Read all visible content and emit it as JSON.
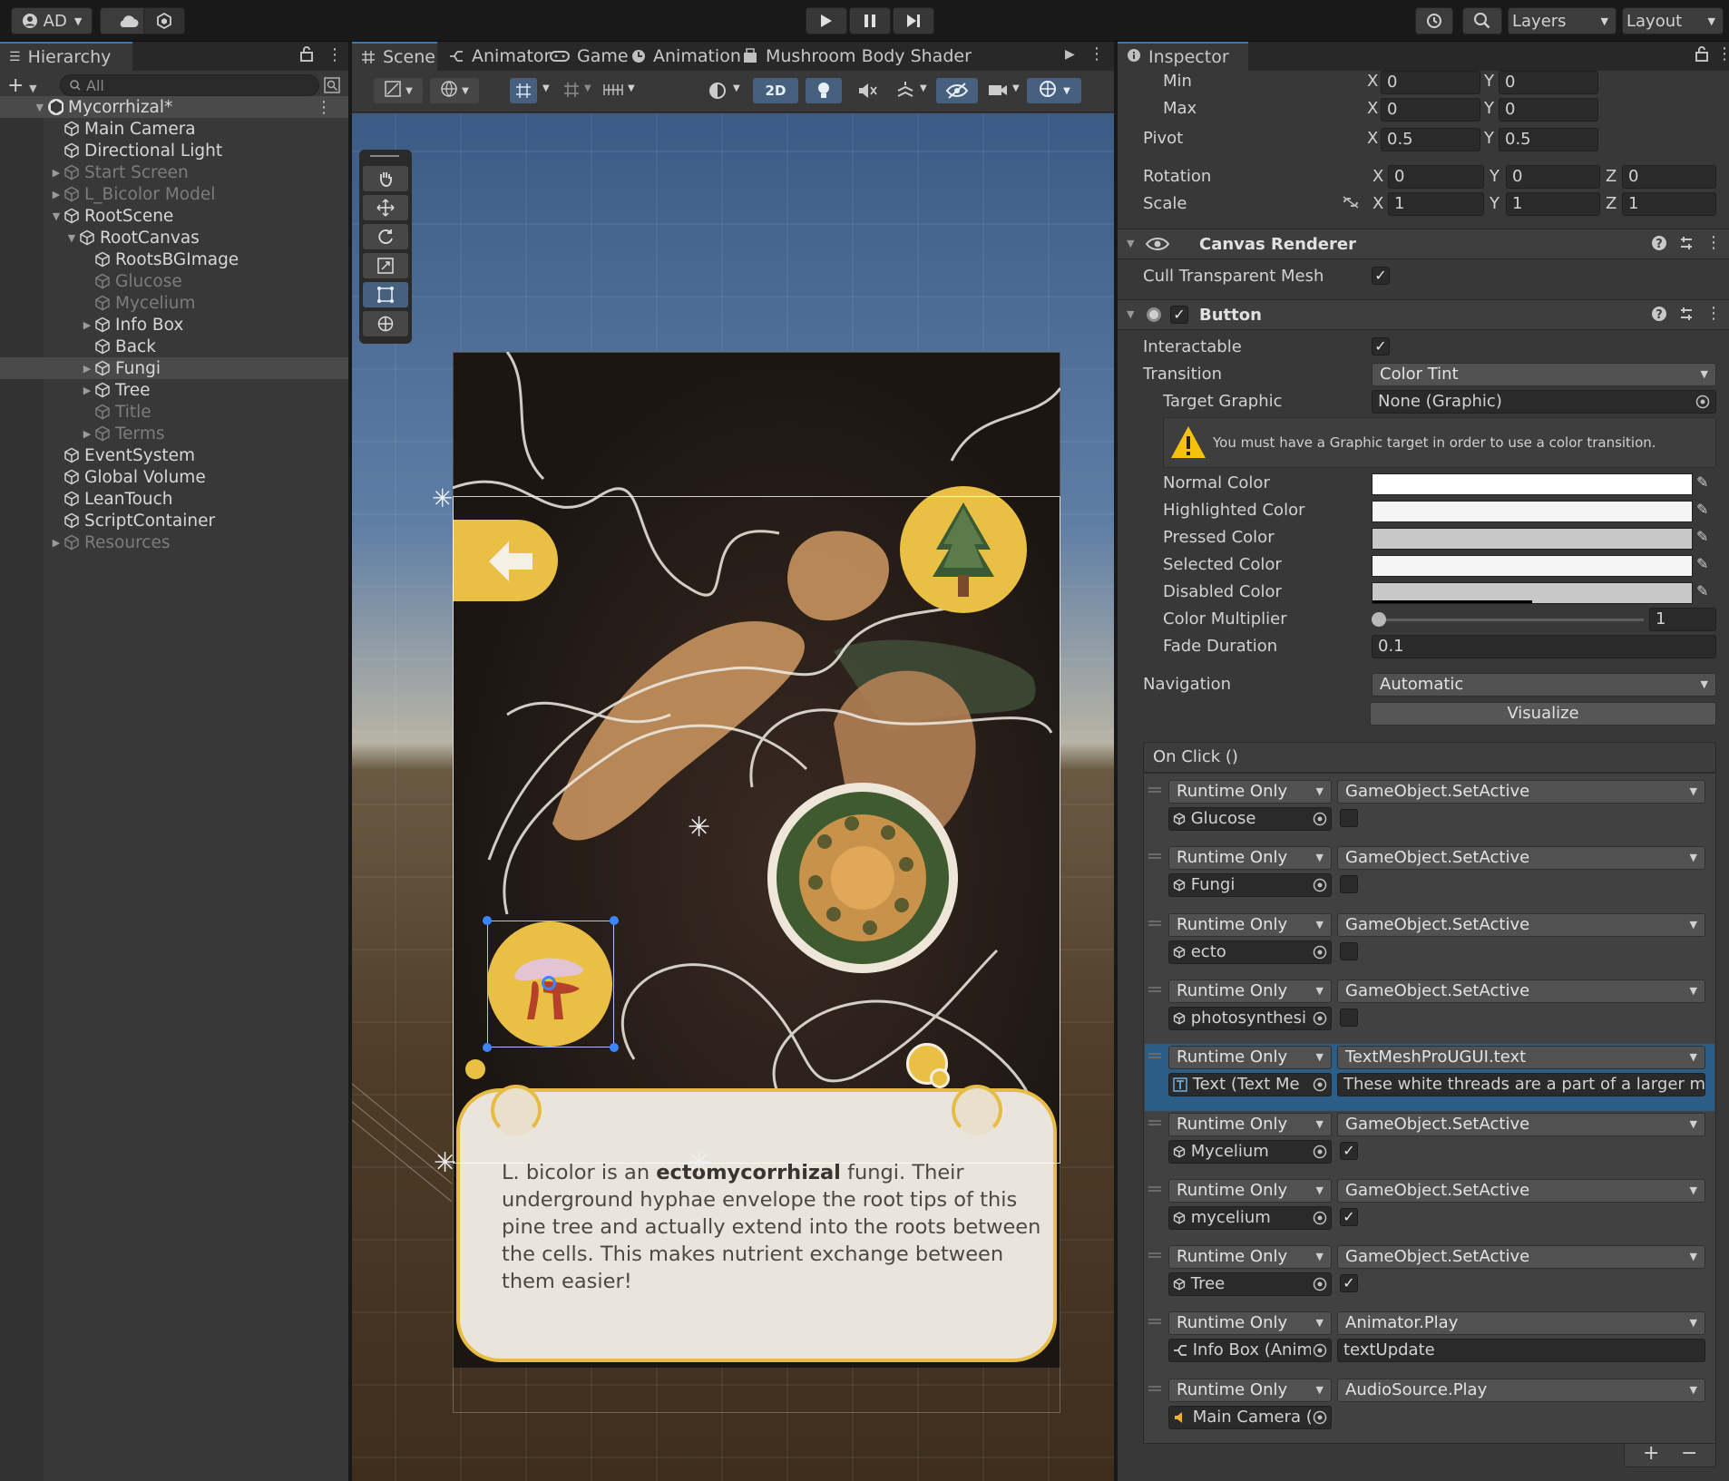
{
  "toolbar": {
    "account": "AD",
    "layers_label": "Layers",
    "layout_label": "Layout"
  },
  "hierarchy": {
    "tab_label": "Hierarchy",
    "search_placeholder": "All",
    "root": "Mycorrhizal*",
    "items": [
      {
        "label": "Main Camera",
        "dim": false
      },
      {
        "label": "Directional Light",
        "dim": false
      },
      {
        "label": "Start Screen",
        "dim": true
      },
      {
        "label": "L_Bicolor Model",
        "dim": true
      },
      {
        "label": "RootScene",
        "dim": false
      },
      {
        "label": "RootCanvas",
        "dim": false
      },
      {
        "label": "RootsBGImage",
        "dim": false
      },
      {
        "label": "Glucose",
        "dim": true
      },
      {
        "label": "Mycelium",
        "dim": true
      },
      {
        "label": "Info Box",
        "dim": false
      },
      {
        "label": "Back",
        "dim": false
      },
      {
        "label": "Fungi",
        "dim": false
      },
      {
        "label": "Tree",
        "dim": false
      },
      {
        "label": "Title",
        "dim": true
      },
      {
        "label": "Terms",
        "dim": true
      },
      {
        "label": "EventSystem",
        "dim": false
      },
      {
        "label": "Global Volume",
        "dim": false
      },
      {
        "label": "LeanTouch",
        "dim": false
      },
      {
        "label": "ScriptContainer",
        "dim": false
      },
      {
        "label": "Resources",
        "dim": true
      }
    ]
  },
  "scene_tabs": [
    "Scene",
    "Animator",
    "Game",
    "Animation",
    "Mushroom Body Shader"
  ],
  "scene_toolbar": {
    "mode_2d": "2D"
  },
  "scene_card": {
    "text_before": "L. bicolor is an ",
    "text_bold": "ectomycorrhizal",
    "text_after": " fungi. Their underground hyphae envelope the root tips of this pine tree and actually extend into the roots between the cells. This makes nutrient exchange between them easier!"
  },
  "inspector": {
    "tab_label": "Inspector",
    "rect": {
      "min_label": "Min",
      "max_label": "Max",
      "pivot_label": "Pivot",
      "min_x": "0",
      "min_y": "0",
      "max_x": "0",
      "max_y": "0",
      "pivot_x": "0.5",
      "pivot_y": "0.5",
      "rotation_label": "Rotation",
      "scale_label": "Scale",
      "rot": [
        "0",
        "0",
        "0"
      ],
      "scale": [
        "1",
        "1",
        "1"
      ],
      "x": "X",
      "y": "Y",
      "z": "Z"
    },
    "canvas_renderer": {
      "title": "Canvas Renderer",
      "cull_label": "Cull Transparent Mesh",
      "cull": true
    },
    "button": {
      "title": "Button",
      "interactable_label": "Interactable",
      "transition_label": "Transition",
      "transition": "Color Tint",
      "target_label": "Target Graphic",
      "target": "None (Graphic)",
      "warning": "You must have a Graphic target in order to use a color transition.",
      "normal_label": "Normal Color",
      "highlighted_label": "Highlighted Color",
      "pressed_label": "Pressed Color",
      "selected_label": "Selected Color",
      "disabled_label": "Disabled Color",
      "multiplier_label": "Color Multiplier",
      "multiplier": "1",
      "fade_label": "Fade Duration",
      "fade": "0.1",
      "navigation_label": "Navigation",
      "navigation": "Automatic",
      "visualize": "Visualize",
      "onclick_label": "On Click ()",
      "colors": {
        "normal": "#ffffff",
        "highlighted": "#f5f5f5",
        "pressed": "#c8c8c8",
        "selected": "#f5f5f5",
        "disabled": "#c8c8c8"
      }
    },
    "events": [
      {
        "runtime": "Runtime Only",
        "func": "GameObject.SetActive",
        "object": "Glucose",
        "arg_type": "check",
        "arg": false,
        "obj_icon": "cube"
      },
      {
        "runtime": "Runtime Only",
        "func": "GameObject.SetActive",
        "object": "Fungi",
        "arg_type": "check",
        "arg": false,
        "obj_icon": "cube"
      },
      {
        "runtime": "Runtime Only",
        "func": "GameObject.SetActive",
        "object": "ecto",
        "arg_type": "check",
        "arg": false,
        "obj_icon": "cube"
      },
      {
        "runtime": "Runtime Only",
        "func": "GameObject.SetActive",
        "object": "photosynthesi",
        "arg_type": "check",
        "arg": false,
        "obj_icon": "cube"
      },
      {
        "runtime": "Runtime Only",
        "func": "TextMeshProUGUI.text",
        "object": "Text (Text Me",
        "arg_type": "text",
        "arg": "These white threads are a part of a larger myc",
        "obj_icon": "text",
        "selected": true
      },
      {
        "runtime": "Runtime Only",
        "func": "GameObject.SetActive",
        "object": "Mycelium",
        "arg_type": "check",
        "arg": true,
        "obj_icon": "cube"
      },
      {
        "runtime": "Runtime Only",
        "func": "GameObject.SetActive",
        "object": "mycelium",
        "arg_type": "check",
        "arg": true,
        "obj_icon": "cube"
      },
      {
        "runtime": "Runtime Only",
        "func": "GameObject.SetActive",
        "object": "Tree",
        "arg_type": "check",
        "arg": true,
        "obj_icon": "cube"
      },
      {
        "runtime": "Runtime Only",
        "func": "Animator.Play",
        "object": "Info Box (Anim",
        "arg_type": "text",
        "arg": "textUpdate",
        "obj_icon": "anim"
      },
      {
        "runtime": "Runtime Only",
        "func": "AudioSource.Play",
        "object": "Main Camera (",
        "arg_type": "none",
        "arg": "",
        "obj_icon": "audio"
      }
    ]
  }
}
